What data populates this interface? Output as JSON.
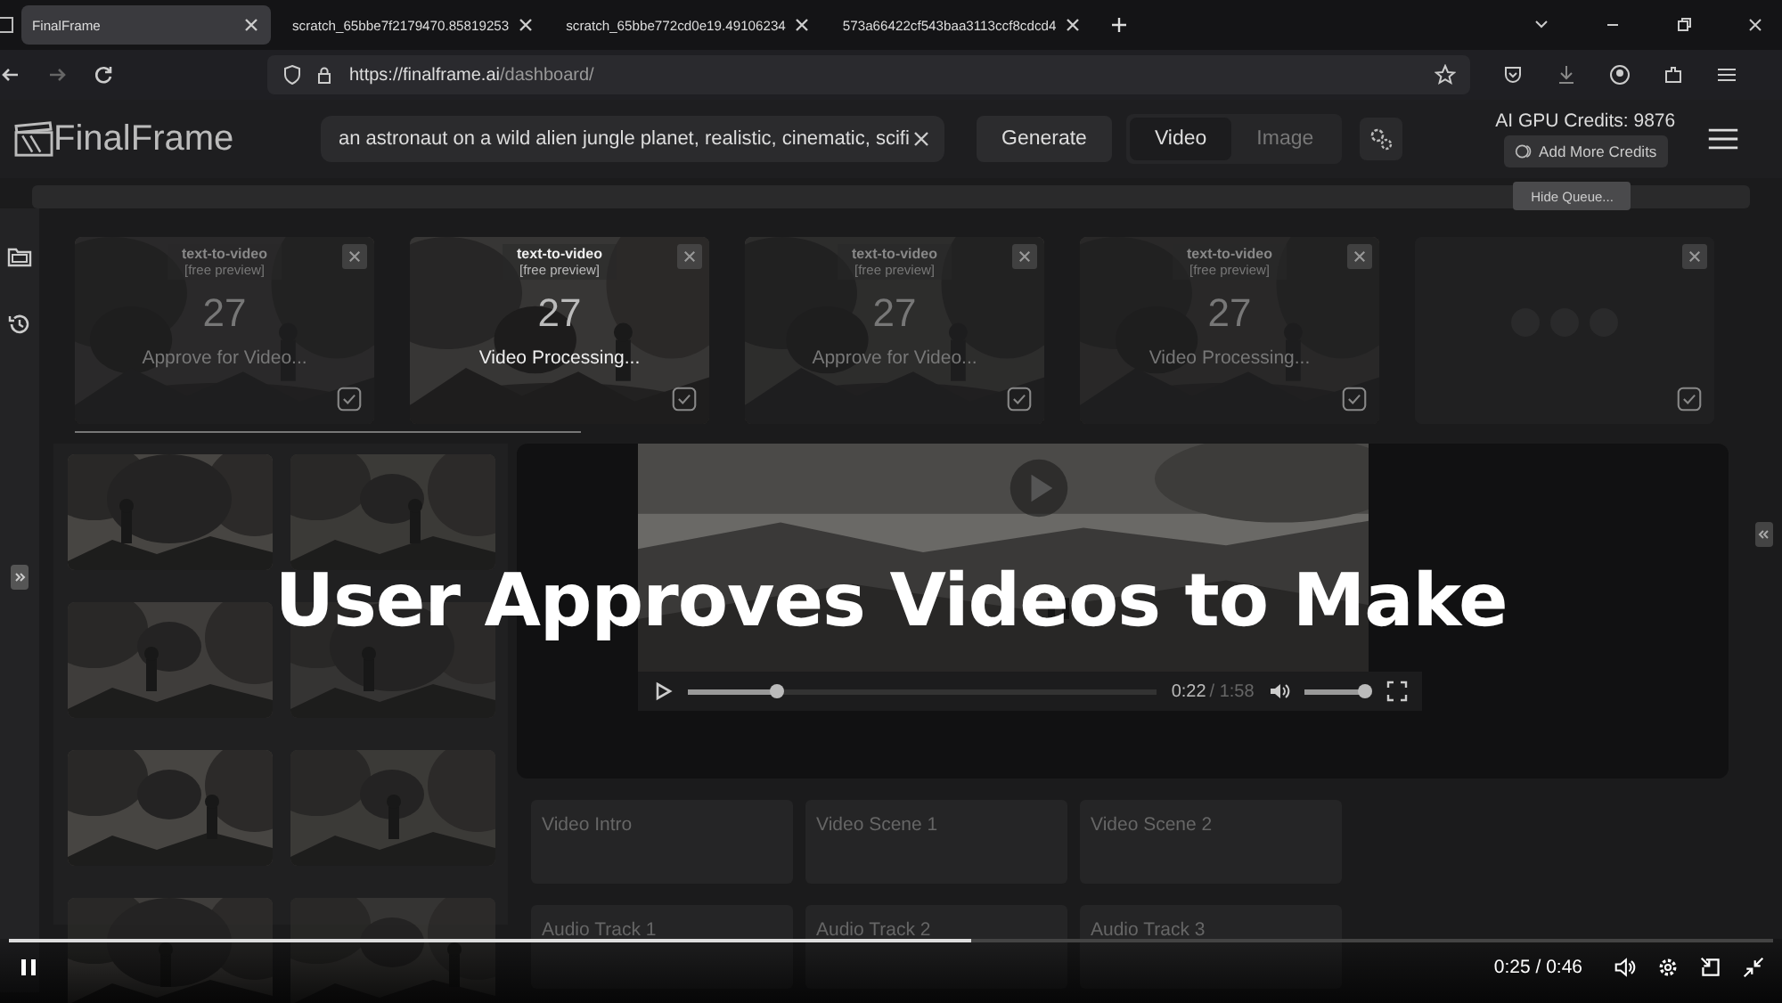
{
  "browser": {
    "tabs": [
      {
        "label": "FinalFrame",
        "selected": true
      },
      {
        "label": "scratch_65bbe7f2179470.85819253",
        "selected": false
      },
      {
        "label": "scratch_65bbe772cd0e19.49106234",
        "selected": false
      },
      {
        "label": "573a66422cf543baa3113ccf8cdcd4",
        "selected": false
      }
    ],
    "url_host": "https://finalframe.ai",
    "url_path": "/dashboard/"
  },
  "header": {
    "logo": "FinalFrame",
    "prompt": "an astronaut on a wild alien jungle planet, realistic, cinematic, scifi",
    "generate": "Generate",
    "modes": [
      {
        "label": "Video",
        "selected": true
      },
      {
        "label": "Image",
        "selected": false
      }
    ],
    "credits": "AI GPU Credits: 9876",
    "add_credits": "Add More Credits",
    "hide_queue": "Hide Queue..."
  },
  "queue": [
    {
      "kind": "job",
      "type": "text-to-video",
      "tag": "[free preview]",
      "count": "27",
      "status": "Approve for Video...",
      "highlighted": false
    },
    {
      "kind": "job",
      "type": "text-to-video",
      "tag": "[free preview]",
      "count": "27",
      "status": "Video Processing...",
      "highlighted": true
    },
    {
      "kind": "job",
      "type": "text-to-video",
      "tag": "[free preview]",
      "count": "27",
      "status": "Approve for Video...",
      "highlighted": false
    },
    {
      "kind": "job",
      "type": "text-to-video",
      "tag": "[free preview]",
      "count": "27",
      "status": "Video Processing...",
      "highlighted": false
    },
    {
      "kind": "loading"
    }
  ],
  "gallery": [
    {
      "kind": "picture"
    },
    {
      "kind": "picture"
    },
    {
      "kind": "picture"
    },
    {
      "kind": "picture"
    },
    {
      "kind": "picture"
    },
    {
      "kind": "picture"
    },
    {
      "kind": "picture"
    },
    {
      "kind": "picture"
    }
  ],
  "player": {
    "time": "0:22",
    "duration": "/ 1:58",
    "level": 0.19,
    "volume": {
      "level": 0.92
    }
  },
  "scenes": [
    "Video Intro",
    "Video Scene 1",
    "Video Scene 2"
  ],
  "audio": [
    "Audio Track 1",
    "Audio Track 2",
    "Audio Track 3"
  ],
  "caption": "User Approves Videos to Make",
  "recording": {
    "level": 0.545,
    "time": "0:25 / 0:46"
  }
}
